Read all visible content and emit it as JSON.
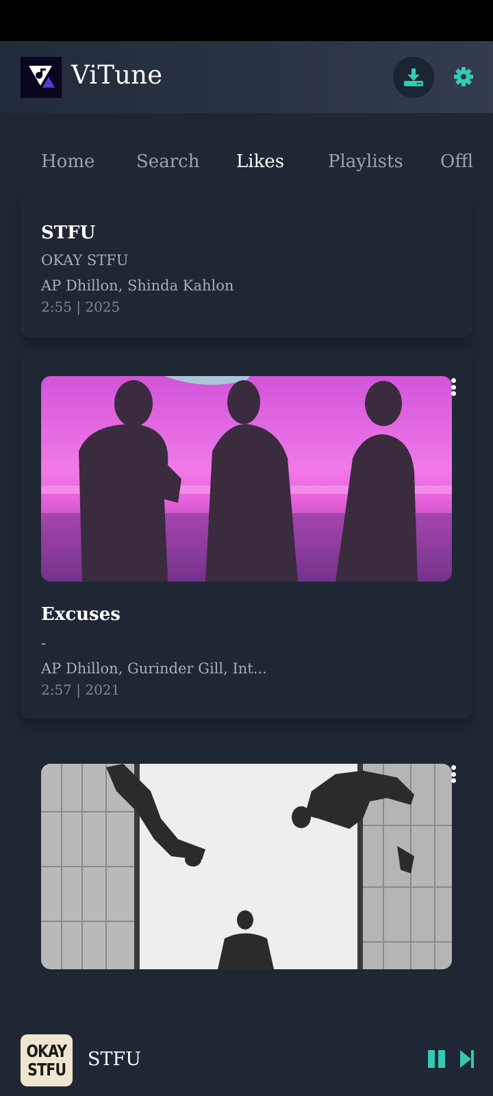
{
  "app": {
    "title": "ViTune",
    "accent_color": "#36c9b5"
  },
  "header": {
    "download_icon": "download-icon",
    "settings_icon": "gear-icon"
  },
  "tabs": [
    {
      "label": "Home",
      "active": false
    },
    {
      "label": "Search",
      "active": false
    },
    {
      "label": "Likes",
      "active": true
    },
    {
      "label": "Playlists",
      "active": false
    },
    {
      "label": "Offline",
      "active": false
    }
  ],
  "songs": [
    {
      "title": "STFU",
      "album": "OKAY STFU",
      "artists": "AP Dhillon, Shinda Kahlon",
      "meta": "2:55 | 2025"
    },
    {
      "title": "Excuses",
      "album": "-",
      "artists": "AP Dhillon, Gurinder Gill, Int...",
      "meta": "2:57 | 2021"
    },
    {
      "title": "",
      "album": "",
      "artists": "",
      "meta": ""
    }
  ],
  "mini_player": {
    "title": "STFU",
    "thumb_lines": [
      "OKAY",
      "STFU"
    ],
    "pause_icon": "pause-icon",
    "next_icon": "skip-next-icon"
  }
}
